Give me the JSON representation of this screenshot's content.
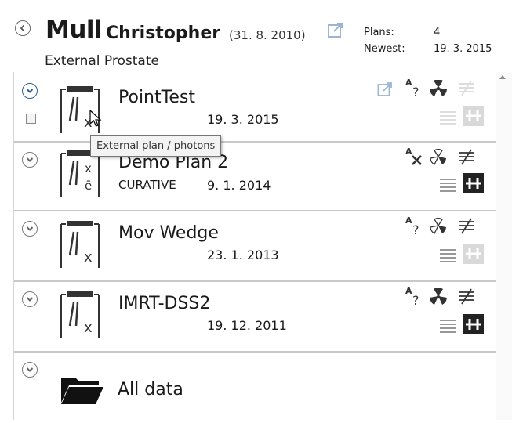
{
  "patient": {
    "last_name": "Mull",
    "first_name": "Christopher",
    "birth_date": "(31. 8. 2010)",
    "diagnosis": "External Prostate",
    "plans_label": "Plans:",
    "plans_count": "4",
    "newest_label": "Newest:",
    "newest_date": "19. 3. 2015"
  },
  "plans": [
    {
      "name": "PointTest",
      "intent": "",
      "date": "19. 3. 2015",
      "icon": "external-plan-photons-icon",
      "label_suffix": "x",
      "status": "unknown",
      "selected": true
    },
    {
      "name": "Demo Plan 2",
      "intent": "CURATIVE",
      "date": "9. 1. 2014",
      "icon": "external-plan-photons-electrons-icon",
      "label_suffix": "x/e",
      "status": "rejected",
      "selected": false
    },
    {
      "name": "Mov Wedge",
      "intent": "",
      "date": "23. 1. 2013",
      "icon": "external-plan-photons-icon",
      "label_suffix": "x",
      "status": "unknown",
      "selected": false
    },
    {
      "name": "IMRT-DSS2",
      "intent": "",
      "date": "19. 12. 2011",
      "icon": "external-plan-photons-icon",
      "label_suffix": "x",
      "status": "unknown",
      "selected": false
    }
  ],
  "all_data": {
    "label": "All data",
    "icon": "folder-icon"
  },
  "tooltip": {
    "text": "External plan / photons"
  },
  "colors": {
    "selected_chevron": "#2d5f8c",
    "link_icon": "#8aa8c8",
    "separator": "#c9c9c9"
  }
}
